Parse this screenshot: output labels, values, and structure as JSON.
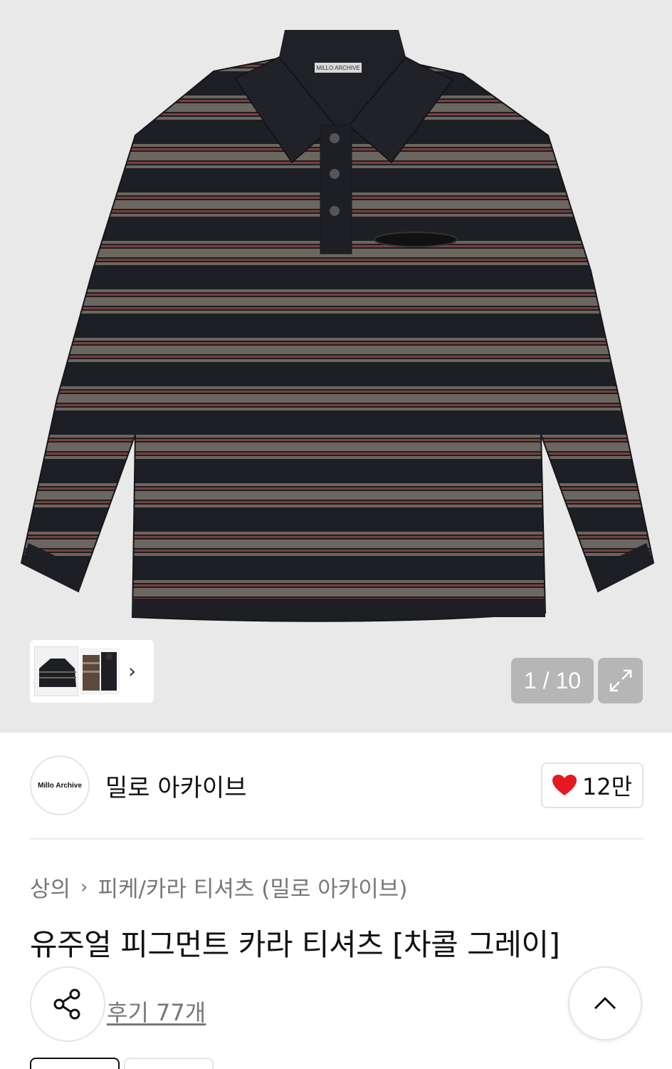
{
  "gallery": {
    "counter": "1 / 10",
    "image_alt_logo_text": "MILLO ARCHIVE",
    "icons": {
      "thumbnail_next": "chevron-right-icon",
      "expand": "expand-icon"
    }
  },
  "brand": {
    "logo_text": "Millo Archive",
    "name": "밀로 아카이브",
    "like_count": "12만",
    "like_icon_color": "#e5191f"
  },
  "breadcrumb": {
    "items": [
      "상의",
      "피케/카라 티셔츠 (밀로 아카이브)"
    ],
    "separator_icon": "chevron-right-icon"
  },
  "product": {
    "title": "유주얼 피그먼트 카라 티셔츠 [차콜 그레이]"
  },
  "actions": {
    "review_link": "후기 77개",
    "share_icon": "share-icon",
    "scroll_top_icon": "chevron-up-icon"
  },
  "colors": {
    "shirt_dark": "#1d1f24",
    "stripe_gray": "#6b6660",
    "stripe_red": "#7a3f3a",
    "background": "#e9e9e9"
  }
}
